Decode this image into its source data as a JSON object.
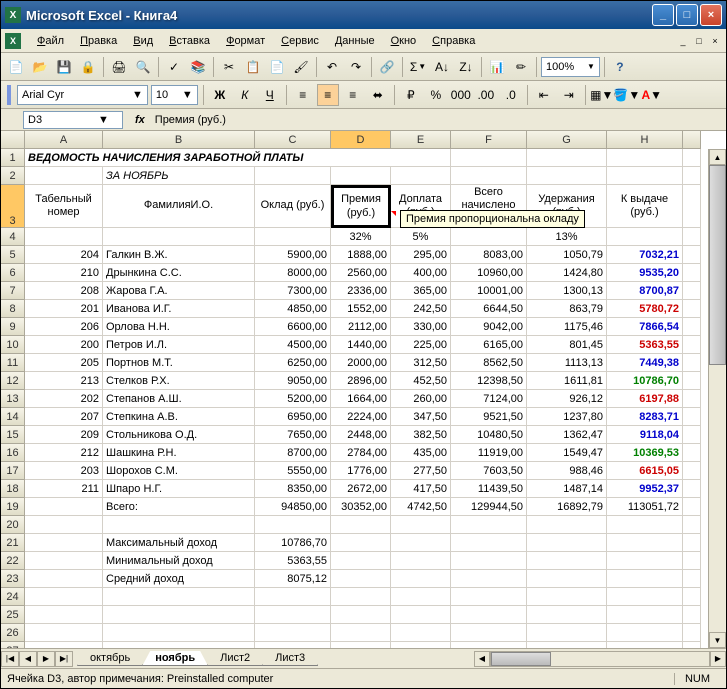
{
  "app": {
    "title": "Microsoft Excel - Книга4"
  },
  "menu": [
    "Файл",
    "Правка",
    "Вид",
    "Вставка",
    "Формат",
    "Сервис",
    "Данные",
    "Окно",
    "Справка"
  ],
  "toolbar": {
    "zoom": "100%"
  },
  "format": {
    "font": "Arial Cyr",
    "size": "10"
  },
  "formulabar": {
    "cell": "D3",
    "content": "Премия (руб.)"
  },
  "columns": [
    "A",
    "B",
    "C",
    "D",
    "E",
    "F",
    "G",
    "H"
  ],
  "tooltip": "Премия пропорциональна окладу",
  "sheet": {
    "title": "ВЕДОМОСТЬ НАЧИСЛЕНИЯ ЗАРАБОТНОЙ ПЛАТЫ",
    "subtitle": "ЗА НОЯБРЬ",
    "headers": [
      "Табельный номер",
      "ФамилияИ.О.",
      "Оклад (руб.)",
      "Премия (руб.)",
      "Доплата (руб.)",
      "Всего начислено (руб.)",
      "Удержания (руб.)",
      "К выдаче (руб.)"
    ],
    "percents": {
      "d": "32%",
      "e": "5%",
      "g": "13%"
    },
    "rows": [
      {
        "n": "204",
        "name": "Галкин В.Ж.",
        "c": "5900,00",
        "d": "1888,00",
        "e": "295,00",
        "f": "8083,00",
        "g": "1050,79",
        "h": "7032,21",
        "cls": "blue"
      },
      {
        "n": "210",
        "name": "Дрынкина С.С.",
        "c": "8000,00",
        "d": "2560,00",
        "e": "400,00",
        "f": "10960,00",
        "g": "1424,80",
        "h": "9535,20",
        "cls": "blue"
      },
      {
        "n": "208",
        "name": "Жарова Г.А.",
        "c": "7300,00",
        "d": "2336,00",
        "e": "365,00",
        "f": "10001,00",
        "g": "1300,13",
        "h": "8700,87",
        "cls": "blue"
      },
      {
        "n": "201",
        "name": "Иванова И.Г.",
        "c": "4850,00",
        "d": "1552,00",
        "e": "242,50",
        "f": "6644,50",
        "g": "863,79",
        "h": "5780,72",
        "cls": "red"
      },
      {
        "n": "206",
        "name": "Орлова Н.Н.",
        "c": "6600,00",
        "d": "2112,00",
        "e": "330,00",
        "f": "9042,00",
        "g": "1175,46",
        "h": "7866,54",
        "cls": "blue"
      },
      {
        "n": "200",
        "name": "Петров И.Л.",
        "c": "4500,00",
        "d": "1440,00",
        "e": "225,00",
        "f": "6165,00",
        "g": "801,45",
        "h": "5363,55",
        "cls": "red"
      },
      {
        "n": "205",
        "name": "Портнов М.Т.",
        "c": "6250,00",
        "d": "2000,00",
        "e": "312,50",
        "f": "8562,50",
        "g": "1113,13",
        "h": "7449,38",
        "cls": "blue"
      },
      {
        "n": "213",
        "name": "Стелков Р.Х.",
        "c": "9050,00",
        "d": "2896,00",
        "e": "452,50",
        "f": "12398,50",
        "g": "1611,81",
        "h": "10786,70",
        "cls": "green"
      },
      {
        "n": "202",
        "name": "Степанов А.Ш.",
        "c": "5200,00",
        "d": "1664,00",
        "e": "260,00",
        "f": "7124,00",
        "g": "926,12",
        "h": "6197,88",
        "cls": "red"
      },
      {
        "n": "207",
        "name": "Степкина А.В.",
        "c": "6950,00",
        "d": "2224,00",
        "e": "347,50",
        "f": "9521,50",
        "g": "1237,80",
        "h": "8283,71",
        "cls": "blue"
      },
      {
        "n": "209",
        "name": "Стольникова О.Д.",
        "c": "7650,00",
        "d": "2448,00",
        "e": "382,50",
        "f": "10480,50",
        "g": "1362,47",
        "h": "9118,04",
        "cls": "blue"
      },
      {
        "n": "212",
        "name": "Шашкина Р.Н.",
        "c": "8700,00",
        "d": "2784,00",
        "e": "435,00",
        "f": "11919,00",
        "g": "1549,47",
        "h": "10369,53",
        "cls": "green"
      },
      {
        "n": "203",
        "name": "Шорохов С.М.",
        "c": "5550,00",
        "d": "1776,00",
        "e": "277,50",
        "f": "7603,50",
        "g": "988,46",
        "h": "6615,05",
        "cls": "red"
      },
      {
        "n": "211",
        "name": "Шпаро Н.Г.",
        "c": "8350,00",
        "d": "2672,00",
        "e": "417,50",
        "f": "11439,50",
        "g": "1487,14",
        "h": "9952,37",
        "cls": "blue"
      }
    ],
    "total": {
      "label": "Всего:",
      "c": "94850,00",
      "d": "30352,00",
      "e": "4742,50",
      "f": "129944,50",
      "g": "16892,79",
      "h": "113051,72"
    },
    "stats": [
      {
        "label": "Максимальный доход",
        "v": "10786,70"
      },
      {
        "label": "Минимальный доход",
        "v": "5363,55"
      },
      {
        "label": "Средний доход",
        "v": "8075,12"
      }
    ]
  },
  "tabs": [
    "октябрь",
    "ноябрь",
    "Лист2",
    "Лист3"
  ],
  "active_tab": 1,
  "status": {
    "text": "Ячейка D3, автор примечания: Preinstalled computer",
    "num": "NUM"
  }
}
